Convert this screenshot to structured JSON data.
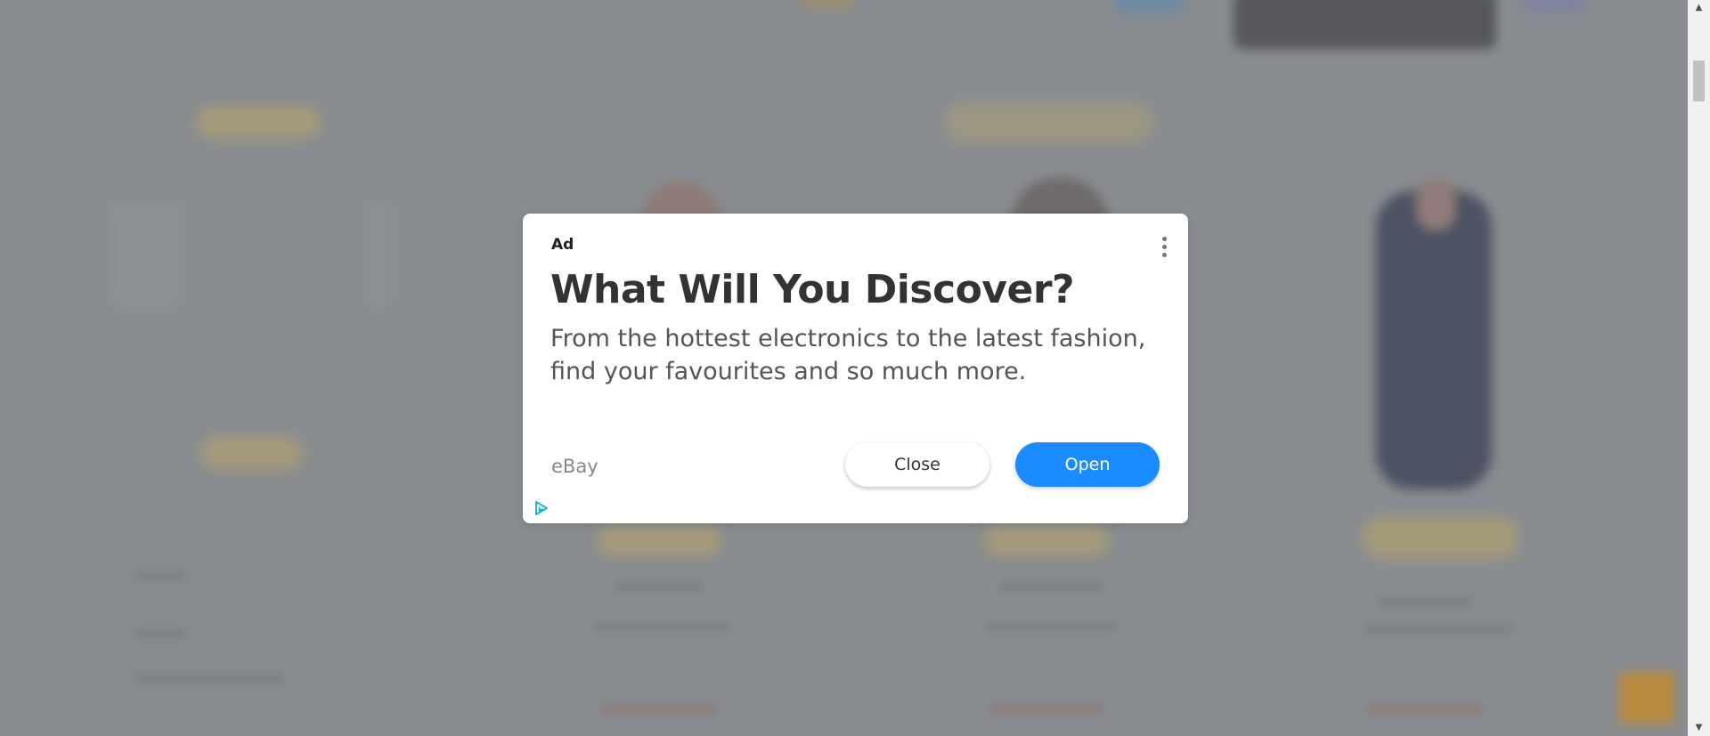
{
  "ad": {
    "label": "Ad",
    "title": "What Will You Discover?",
    "body": "From the hottest electronics to the latest fashion, find your favourites and so much more.",
    "advertiser": "eBay",
    "close_label": "Close",
    "open_label": "Open",
    "menu_icon": "more-vert-icon",
    "adchoices_icon": "adchoices-icon"
  },
  "scrollbar": {
    "up_arrow": "▲",
    "down_arrow": "▼"
  },
  "colors": {
    "overlay": "#898c90",
    "modal_background": "#ffffff",
    "open_button": "#1a8cff",
    "title_text": "#333333",
    "body_text": "#555555",
    "advertiser_text": "#888888",
    "adchoices": "#00aecd"
  }
}
